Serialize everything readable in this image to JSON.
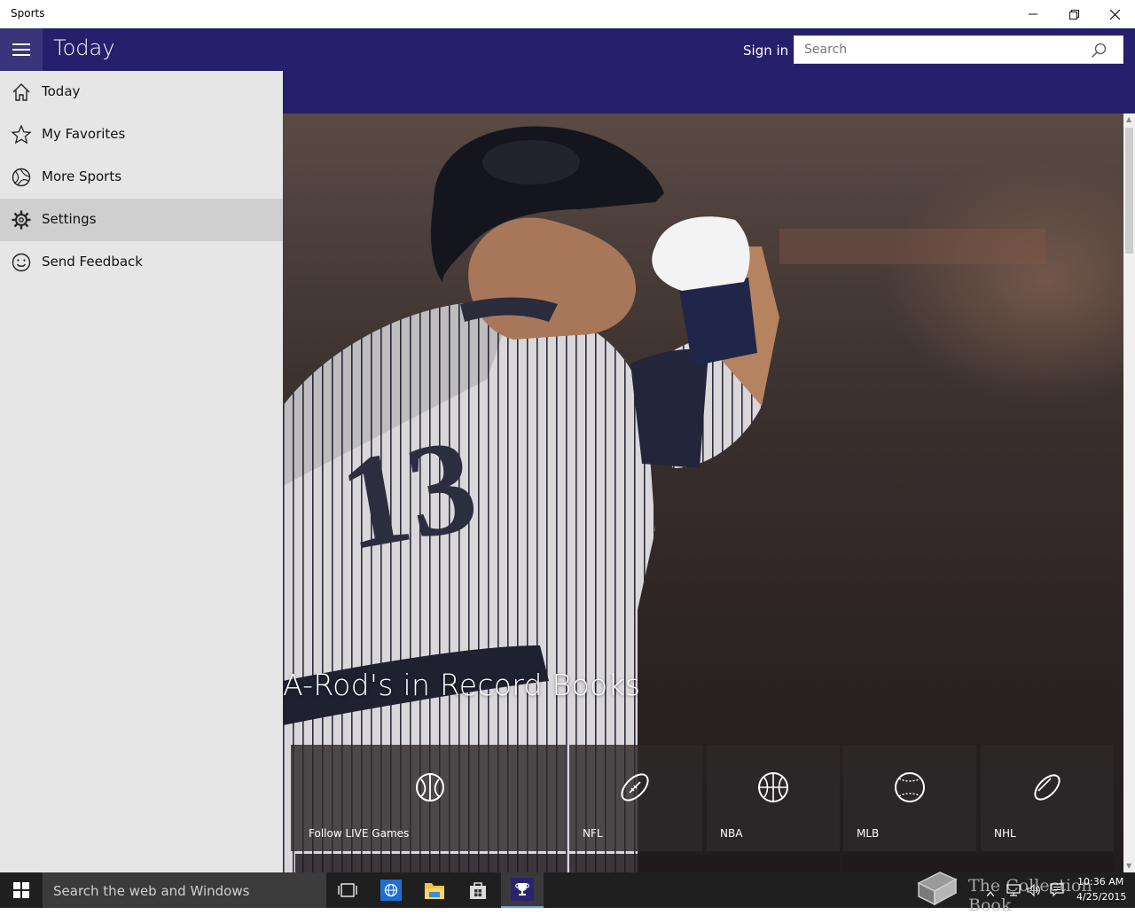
{
  "window": {
    "title": "Sports"
  },
  "header": {
    "page_title": "Today",
    "sign_in": "Sign in",
    "search_placeholder": "Search"
  },
  "nav": {
    "items": [
      {
        "label": "Today",
        "icon": "home-icon",
        "selected": false
      },
      {
        "label": "My Favorites",
        "icon": "star-icon",
        "selected": false
      },
      {
        "label": "More Sports",
        "icon": "ball-icon",
        "selected": false
      },
      {
        "label": "Settings",
        "icon": "gear-icon",
        "selected": true
      },
      {
        "label": "Send Feedback",
        "icon": "smiley-icon",
        "selected": false
      }
    ]
  },
  "hero": {
    "headline": "A-Rod's in Record Books",
    "jersey_number": "13",
    "tiles": [
      {
        "label": "Follow LIVE Games",
        "icon": "live-games-icon"
      },
      {
        "label": "NFL",
        "icon": "football-icon"
      },
      {
        "label": "NBA",
        "icon": "basketball-icon"
      },
      {
        "label": "MLB",
        "icon": "baseball-icon"
      },
      {
        "label": "NHL",
        "icon": "hockey-puck-icon"
      }
    ]
  },
  "taskbar": {
    "search_placeholder": "Search the web and Windows",
    "watermark": "The Collection Book",
    "time": "10:36 AM",
    "date": "4/25/2015"
  },
  "colors": {
    "header_bg": "#261f6b",
    "pane_bg": "#e6e6e6",
    "pane_selected": "#cfcfcf",
    "taskbar_bg": "#1f1f1f"
  }
}
